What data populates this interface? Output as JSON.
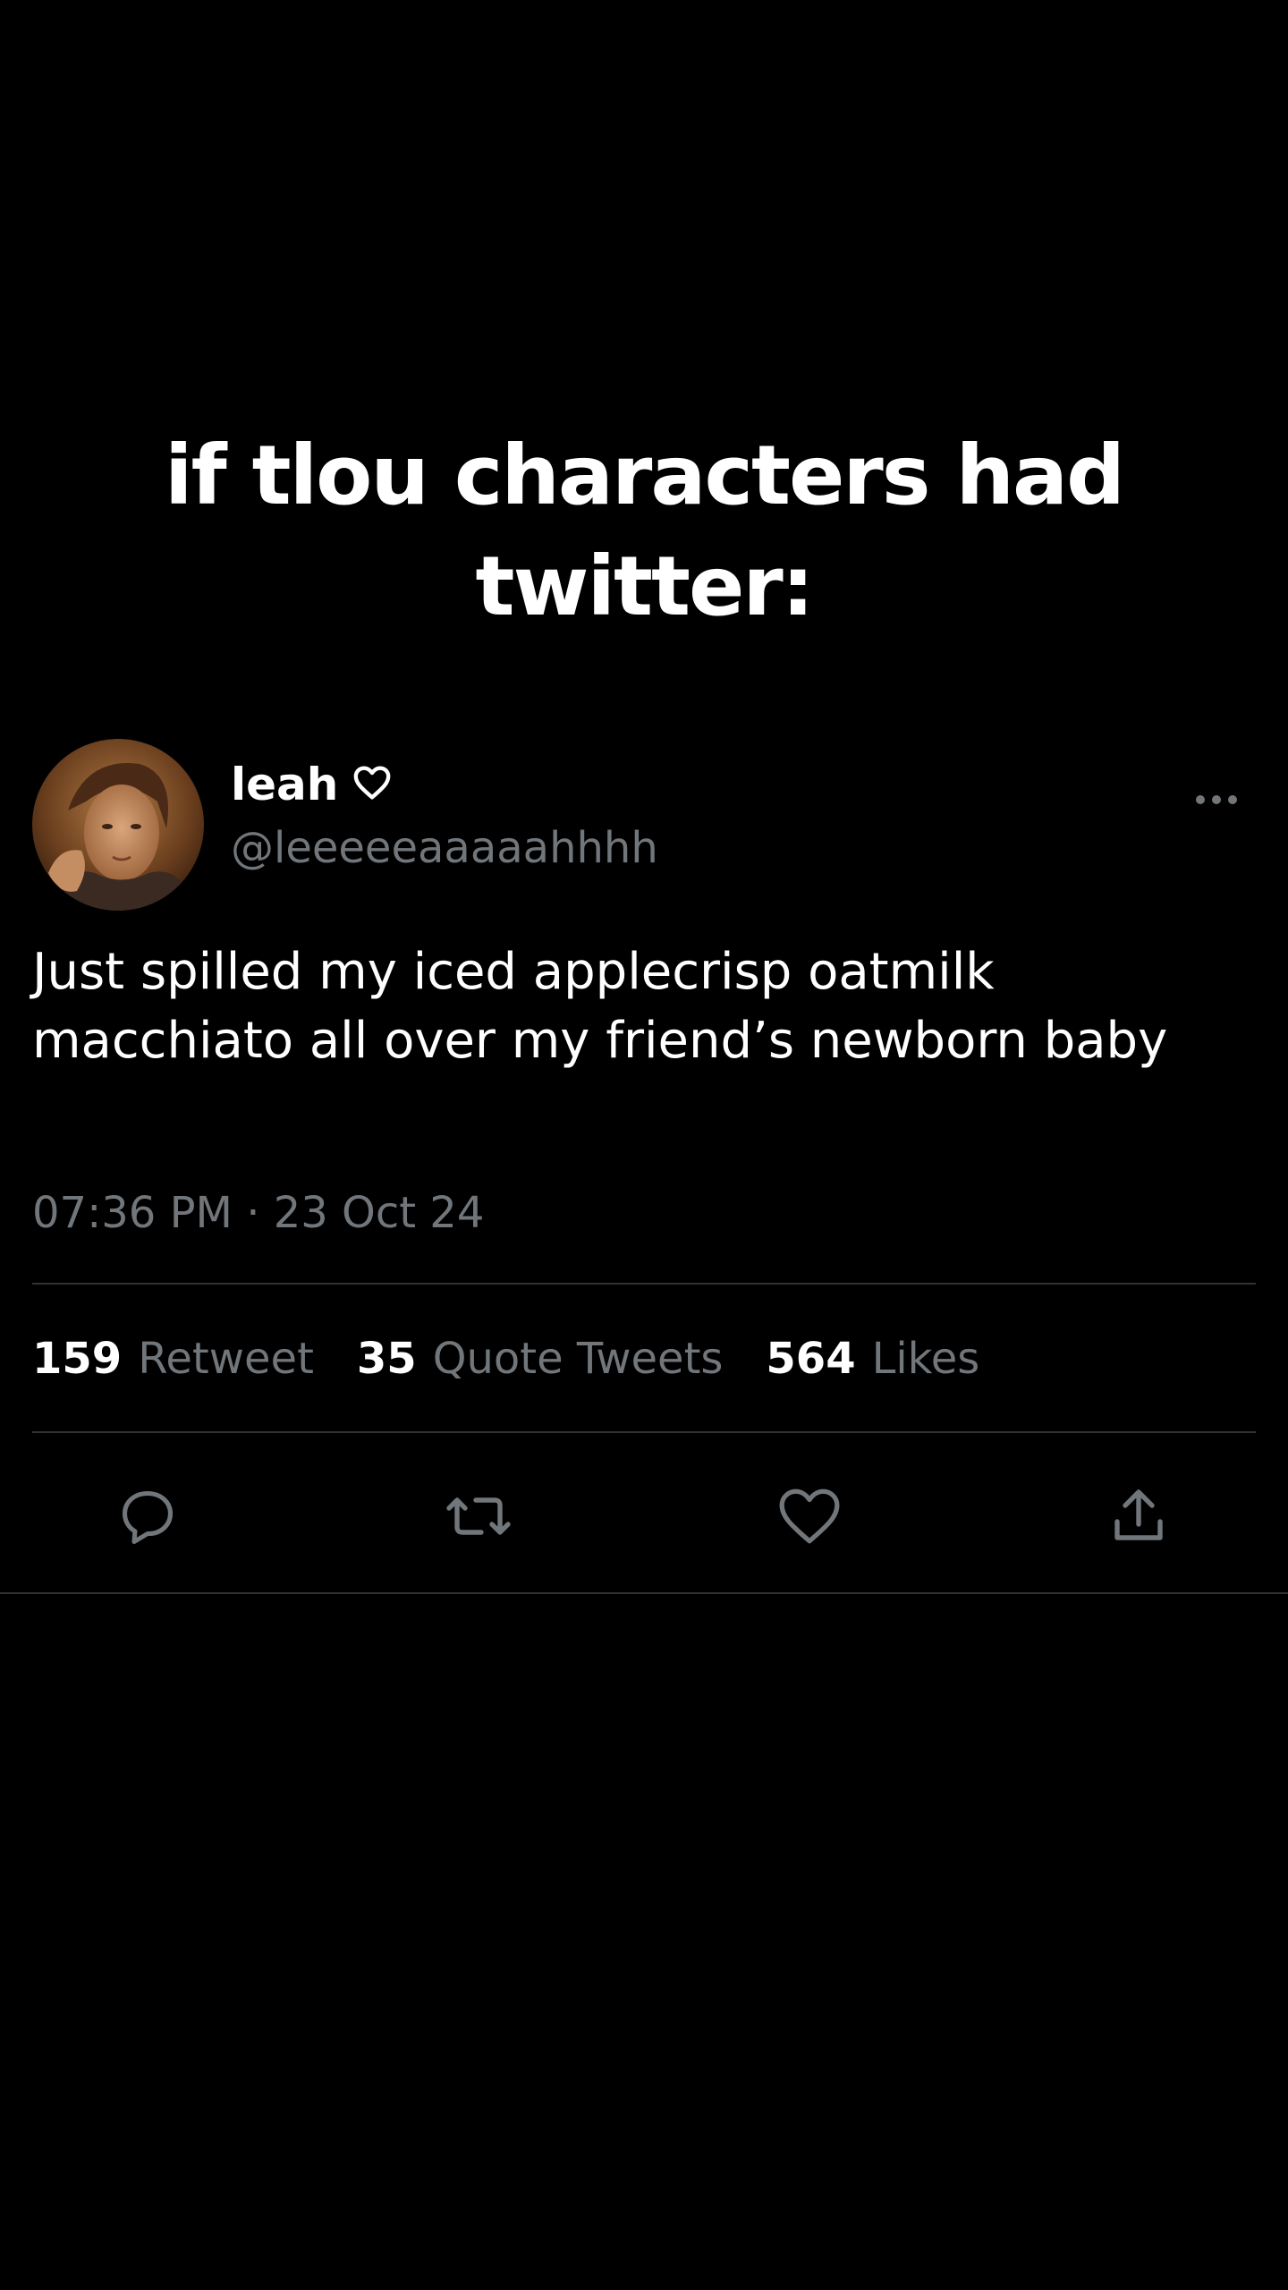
{
  "caption": {
    "line1": "if tlou characters had",
    "line2": "twitter:"
  },
  "tweet": {
    "display_name": "leah",
    "handle": "@leeeeeaaaaahhhh",
    "text": "Just spilled my iced applecrisp oatmilk macchiato all over my friend’s newborn baby",
    "timestamp": "07:36 PM · 23 Oct 24",
    "stats": {
      "retweets_count": "159",
      "retweets_label": "Retweet",
      "quotes_count": "35",
      "quotes_label": "Quote Tweets",
      "likes_count": "564",
      "likes_label": "Likes"
    },
    "actions": [
      "reply-icon",
      "retweet-icon",
      "like-icon",
      "share-icon"
    ]
  },
  "colors": {
    "background": "#000000",
    "primary_text": "#ffffff",
    "secondary_text": "#71767b",
    "divider": "#2f3336"
  }
}
